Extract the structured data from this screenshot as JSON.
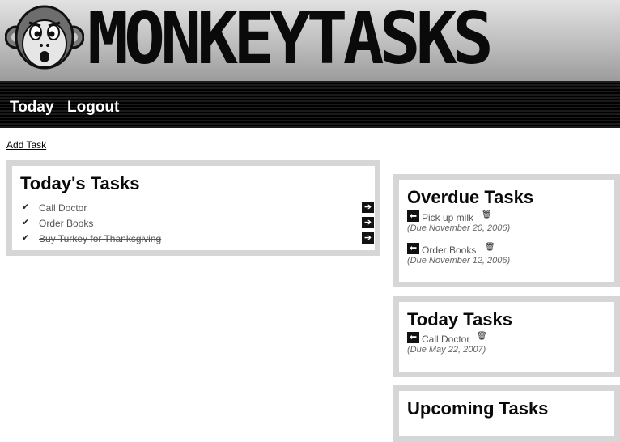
{
  "header": {
    "brand": "MONKEYTASKS"
  },
  "nav": {
    "today": "Today",
    "logout": "Logout"
  },
  "actions": {
    "add_task": "Add Task"
  },
  "todays_tasks": {
    "title": "Today's Tasks",
    "items": [
      {
        "name": "Call Doctor",
        "done": false
      },
      {
        "name": "Order Books",
        "done": false
      },
      {
        "name": "Buy Turkey for Thanksgiving",
        "done": true
      }
    ]
  },
  "overdue": {
    "title": "Overdue Tasks",
    "items": [
      {
        "name": "Pick up milk",
        "due": "(Due November 20, 2006)"
      },
      {
        "name": "Order Books",
        "due": "(Due November 12, 2006)"
      }
    ]
  },
  "today_tasks": {
    "title": "Today Tasks",
    "items": [
      {
        "name": "Call Doctor",
        "due": "(Due May 22, 2007)"
      }
    ]
  },
  "upcoming": {
    "title": "Upcoming Tasks"
  },
  "icons": {
    "check": "check-icon",
    "move_right": "arrow-right-icon",
    "move_left": "arrow-left-icon",
    "delete": "trash-icon",
    "logo": "monkey-logo-icon"
  }
}
